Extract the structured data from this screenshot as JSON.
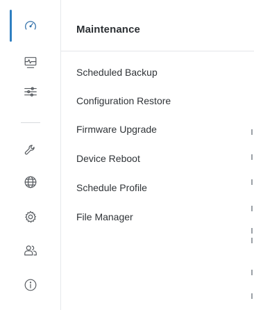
{
  "sidebar": {
    "items": [
      {
        "icon": "speedometer-icon",
        "active": true
      },
      {
        "icon": "monitor-icon",
        "active": false
      },
      {
        "icon": "sliders-icon",
        "active": false
      },
      {
        "icon": "wrench-icon",
        "active": false
      },
      {
        "icon": "globe-icon",
        "active": false
      },
      {
        "icon": "gear-icon",
        "active": false
      },
      {
        "icon": "users-icon",
        "active": false
      },
      {
        "icon": "info-icon",
        "active": false
      }
    ],
    "accent": "#2f7fc1"
  },
  "panel": {
    "title": "Maintenance",
    "items": [
      {
        "label": "Scheduled Backup"
      },
      {
        "label": "Configuration Restore"
      },
      {
        "label": "Firmware Upgrade"
      },
      {
        "label": "Device Reboot"
      },
      {
        "label": "Schedule Profile"
      },
      {
        "label": "File Manager"
      }
    ]
  }
}
